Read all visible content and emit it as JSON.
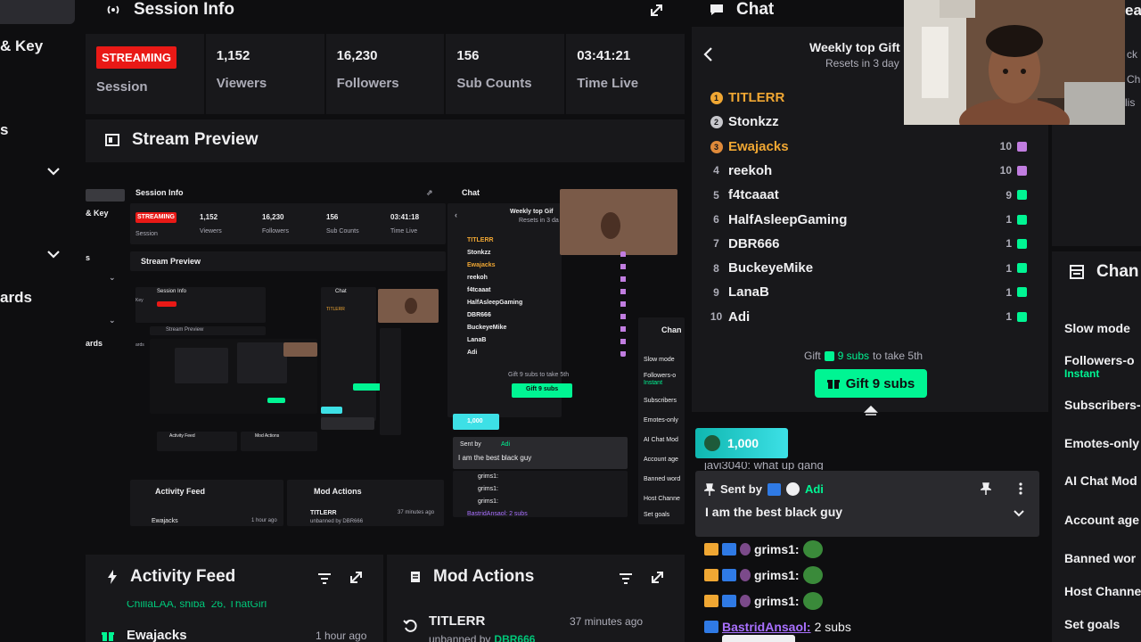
{
  "sidebar": {
    "items": [
      "& Key",
      "s",
      "ards"
    ]
  },
  "session": {
    "title": "Session Info",
    "badge": "STREAMING",
    "badge_label": "Session",
    "stats": [
      {
        "value": "1,152",
        "label": "Viewers"
      },
      {
        "value": "16,230",
        "label": "Followers"
      },
      {
        "value": "156",
        "label": "Sub Counts"
      },
      {
        "value": "03:41:21",
        "label": "Time Live"
      }
    ]
  },
  "preview": {
    "title": "Stream Preview",
    "mini": {
      "session_title": "Session Info",
      "badge": "STREAMING",
      "badge_label": "Session",
      "stats": [
        {
          "value": "1,152",
          "label": "Viewers"
        },
        {
          "value": "16,230",
          "label": "Followers"
        },
        {
          "value": "156",
          "label": "Sub Counts"
        },
        {
          "value": "03:41:18",
          "label": "Time Live"
        }
      ],
      "sidebar_key": "& Key",
      "sidebar_s": "s",
      "sidebar_ards": "ards",
      "preview_title": "Stream Preview",
      "chat_title": "Chat",
      "weekly": "Weekly top Gif",
      "resets": "Resets in 3 da",
      "names": [
        "TITLERR",
        "Stonkzz",
        "Ewajacks",
        "reekoh",
        "f4tcaaat",
        "HalfAsleepGaming",
        "DBR666",
        "BuckeyeMike",
        "LanaB",
        "Adi"
      ],
      "gift_text": "Gift 9 subs to take 5th",
      "gift_btn": "Gift 9 subs",
      "hype": "1,000",
      "sent_by": "Sent by",
      "sender": "Adi",
      "pinned_msg": "I am the best black guy",
      "grims": "grims1:",
      "bastrid": "BastridAnsaol: 2 subs",
      "activity": "Activity Feed",
      "mod": "Mod Actions",
      "ewajacks": "Ewajacks",
      "hour": "1 hour ago",
      "titlerr": "TITLERR",
      "unbanned": "unbanned by DBR666",
      "mins": "37 minutes ago",
      "chan": "Chan",
      "chan_labels": [
        "Slow mode",
        "Followers-o",
        "Instant",
        "Subscribers",
        "Emotes-only",
        "AI Chat Mod",
        "Account age",
        "Banned word",
        "Host Channe",
        "Set goals"
      ],
      "inner_session": "Session Info",
      "inner_chat": "Chat",
      "inner_preview": "Stream Preview",
      "inner_activity": "Activity Feed",
      "inner_mod": "Mod Actions",
      "inner_key": "Key",
      "inner_ards": "ards",
      "inner_titlerr": "TITLERR"
    }
  },
  "activity": {
    "title": "Activity Feed",
    "cut_text": "ChillaLAA, shiba_26, ThatGirl",
    "item_name": "Ewajacks",
    "item_time": "1 hour ago"
  },
  "mod_actions": {
    "title": "Mod Actions",
    "item_name": "TITLERR",
    "item_sub": "unbanned by",
    "item_mod": "DBR666",
    "item_time": "37 minutes ago"
  },
  "chat": {
    "title": "Chat",
    "weekly_title": "Weekly top Gift",
    "resets": "Resets in 3 day",
    "leaderboard": [
      {
        "rank": "1",
        "name": "TITLERR",
        "count": "",
        "color": "#f0a733"
      },
      {
        "rank": "2",
        "name": "Stonkzz",
        "count": "",
        "color": "#efeff1"
      },
      {
        "rank": "3",
        "name": "Ewajacks",
        "count": "10",
        "color": "#f0a733"
      },
      {
        "rank": "4",
        "name": "reekoh",
        "count": "10",
        "color": "#efeff1"
      },
      {
        "rank": "5",
        "name": "f4tcaaat",
        "count": "9",
        "color": "#efeff1"
      },
      {
        "rank": "6",
        "name": "HalfAsleepGaming",
        "count": "1",
        "color": "#efeff1"
      },
      {
        "rank": "7",
        "name": "DBR666",
        "count": "1",
        "color": "#efeff1"
      },
      {
        "rank": "8",
        "name": "BuckeyeMike",
        "count": "1",
        "color": "#efeff1"
      },
      {
        "rank": "9",
        "name": "LanaB",
        "count": "1",
        "color": "#efeff1"
      },
      {
        "rank": "10",
        "name": "Adi",
        "count": "1",
        "color": "#efeff1"
      }
    ],
    "gift_prefix": "Gift",
    "gift_mid": "9 subs",
    "gift_suffix": "to take 5th",
    "gift_button": "Gift 9 subs",
    "hype_value": "1,000",
    "cut_message": "javi3040: what up gang",
    "pinned": {
      "sent_by": "Sent by",
      "sender": "Adi",
      "message": "I am the best black guy"
    },
    "messages": [
      {
        "user": "grims1:"
      },
      {
        "user": "grims1:"
      },
      {
        "user": "grims1:"
      }
    ],
    "sub_user": "BastridAnsaol:",
    "sub_text": "2 subs",
    "partial_right": [
      "ea",
      "ck",
      "Ch",
      "lis"
    ]
  },
  "channel": {
    "title": "Chan",
    "items": [
      {
        "label": "Slow mode"
      },
      {
        "label": "Followers-o",
        "sub": "Instant"
      },
      {
        "label": "Subscribers-"
      },
      {
        "label": "Emotes-only"
      },
      {
        "label": "AI Chat Mod"
      },
      {
        "label": "Account age"
      },
      {
        "label": "Banned wor"
      },
      {
        "label": "Host Channe"
      },
      {
        "label": "Set goals"
      }
    ]
  },
  "colors": {
    "bg": "#0e0e10",
    "panel": "#18181b",
    "accent_green": "#00f593",
    "gold": "#f0a733",
    "live_red": "#e91916",
    "hype_cyan": "#3de0e6"
  }
}
